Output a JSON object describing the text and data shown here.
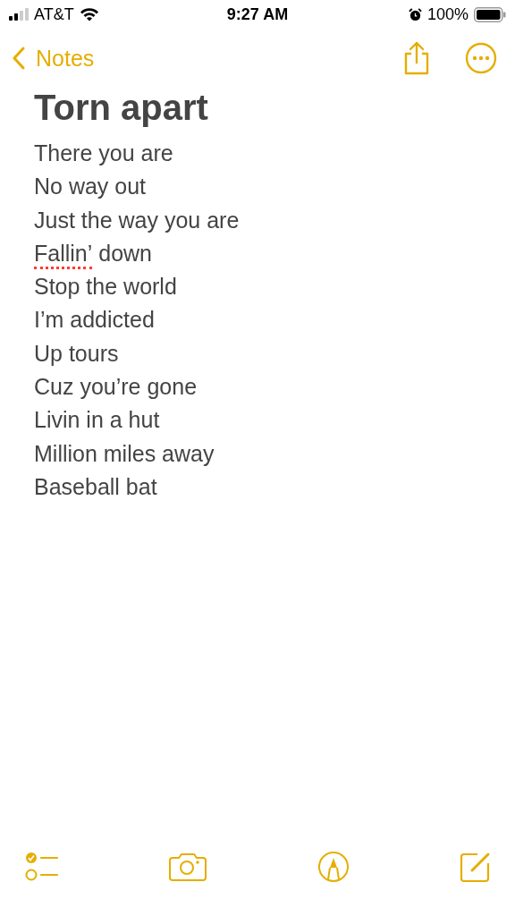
{
  "status_bar": {
    "carrier": "AT&T",
    "time": "9:27 AM",
    "battery": "100%"
  },
  "nav": {
    "back_label": "Notes"
  },
  "note": {
    "title": "Torn apart",
    "lines": [
      {
        "parts": [
          {
            "text": "There you are",
            "misspelled": false
          }
        ]
      },
      {
        "parts": [
          {
            "text": "No way out",
            "misspelled": false
          }
        ]
      },
      {
        "parts": [
          {
            "text": "Just the way you are",
            "misspelled": false
          }
        ]
      },
      {
        "parts": [
          {
            "text": "Fallin’",
            "misspelled": true
          },
          {
            "text": "down",
            "misspelled": false
          }
        ]
      },
      {
        "parts": [
          {
            "text": "Stop the world",
            "misspelled": false
          }
        ]
      },
      {
        "parts": [
          {
            "text": "I’m addicted",
            "misspelled": false
          }
        ]
      },
      {
        "parts": [
          {
            "text": "Up tours",
            "misspelled": false
          }
        ]
      },
      {
        "parts": [
          {
            "text": "Cuz you’re gone",
            "misspelled": false
          }
        ]
      },
      {
        "parts": [
          {
            "text": "Livin in a hut",
            "misspelled": false
          }
        ]
      },
      {
        "parts": [
          {
            "text": "Million miles away",
            "misspelled": false
          }
        ]
      },
      {
        "parts": [
          {
            "text": "Baseball bat",
            "misspelled": false
          }
        ]
      }
    ]
  }
}
